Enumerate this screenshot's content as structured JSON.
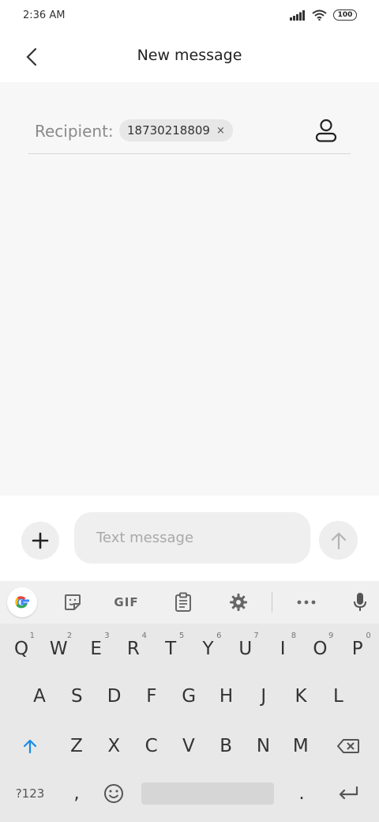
{
  "status_bar": {
    "time": "2:36 AM",
    "battery": "100"
  },
  "header": {
    "title": "New message",
    "back_icon": "chevron-left-icon"
  },
  "recipient": {
    "label": "Recipient:",
    "chip_value": "18730218809",
    "chip_remove": "×",
    "contact_icon": "person-icon"
  },
  "compose": {
    "placeholder": "Text message",
    "add_icon": "plus-icon",
    "send_icon": "arrow-up-icon"
  },
  "keyboard": {
    "toolbar": {
      "gif_label": "GIF",
      "more_icon": "more-dots-icon",
      "mic_icon": "microphone-icon"
    },
    "row1": [
      "Q",
      "W",
      "E",
      "R",
      "T",
      "Y",
      "U",
      "I",
      "O",
      "P"
    ],
    "row1_hints": [
      "1",
      "2",
      "3",
      "4",
      "5",
      "6",
      "7",
      "8",
      "9",
      "0"
    ],
    "row2": [
      "A",
      "S",
      "D",
      "F",
      "G",
      "H",
      "J",
      "K",
      "L"
    ],
    "row3": [
      "Z",
      "X",
      "C",
      "V",
      "B",
      "N",
      "M"
    ],
    "symbols_label": "?123",
    "comma_label": ",",
    "period_label": "."
  },
  "colors": {
    "accent": "#1a8ae6",
    "background": "#f7f7f7"
  }
}
